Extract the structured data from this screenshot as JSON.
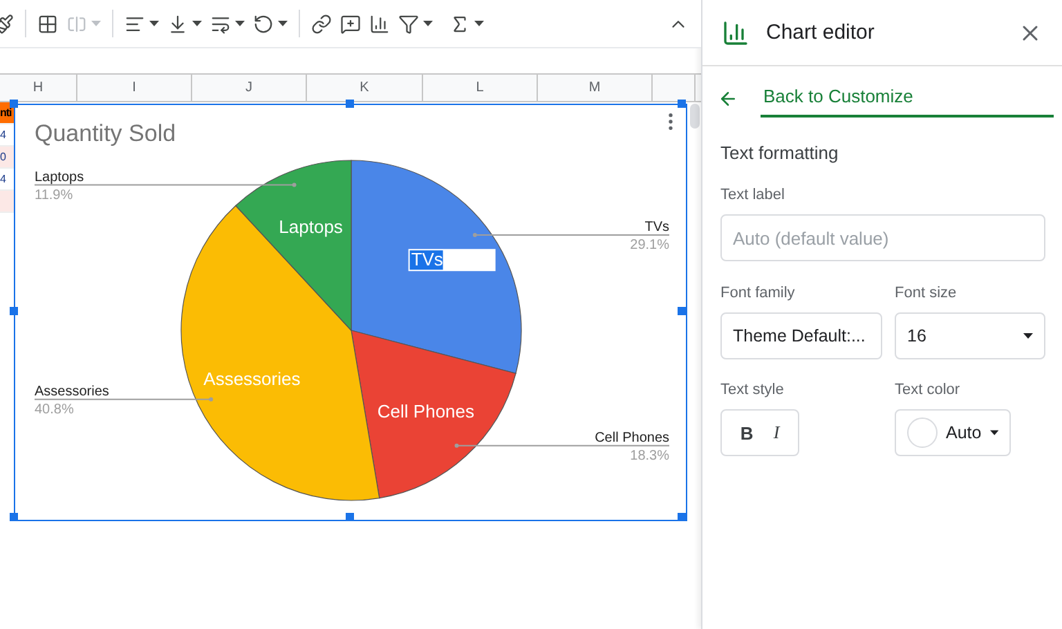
{
  "sheet": {
    "columns": [
      "H",
      "I",
      "J",
      "K",
      "L",
      "M"
    ],
    "cells": [
      {
        "text": "nti",
        "kind": "header"
      },
      {
        "text": "4",
        "kind": "plain"
      },
      {
        "text": "0",
        "kind": "pink"
      },
      {
        "text": "4",
        "kind": "plain"
      },
      {
        "text": "",
        "kind": "pink"
      }
    ]
  },
  "chart": {
    "chart_data": {
      "type": "pie",
      "title": "Quantity Sold",
      "categories": [
        "TVs",
        "Cell Phones",
        "Assessories",
        "Laptops"
      ],
      "values": [
        29.1,
        18.3,
        40.8,
        11.9
      ],
      "colors": [
        "#4a86e8",
        "#ea4335",
        "#fbbc04",
        "#34a853"
      ]
    },
    "inner_labels": [
      "TVs",
      "Cell Phones",
      "Assessories",
      "Laptops"
    ],
    "percent_labels": [
      "29.1%",
      "18.3%",
      "40.8%",
      "11.9%"
    ],
    "editing": [
      true,
      false,
      false,
      false
    ]
  },
  "editor": {
    "title": "Chart editor",
    "back_link": "Back to Customize",
    "section": "Text formatting",
    "text_label": {
      "label": "Text label",
      "placeholder": "Auto (default value)"
    },
    "font_family": {
      "label": "Font family",
      "value": "Theme Default:..."
    },
    "font_size": {
      "label": "Font size",
      "value": "16"
    },
    "text_style": {
      "label": "Text style",
      "buttons": [
        {
          "text": "B",
          "kind": "bold"
        },
        {
          "text": "I",
          "kind": "italic"
        }
      ]
    },
    "text_color": {
      "label": "Text color",
      "value": "Auto"
    }
  }
}
